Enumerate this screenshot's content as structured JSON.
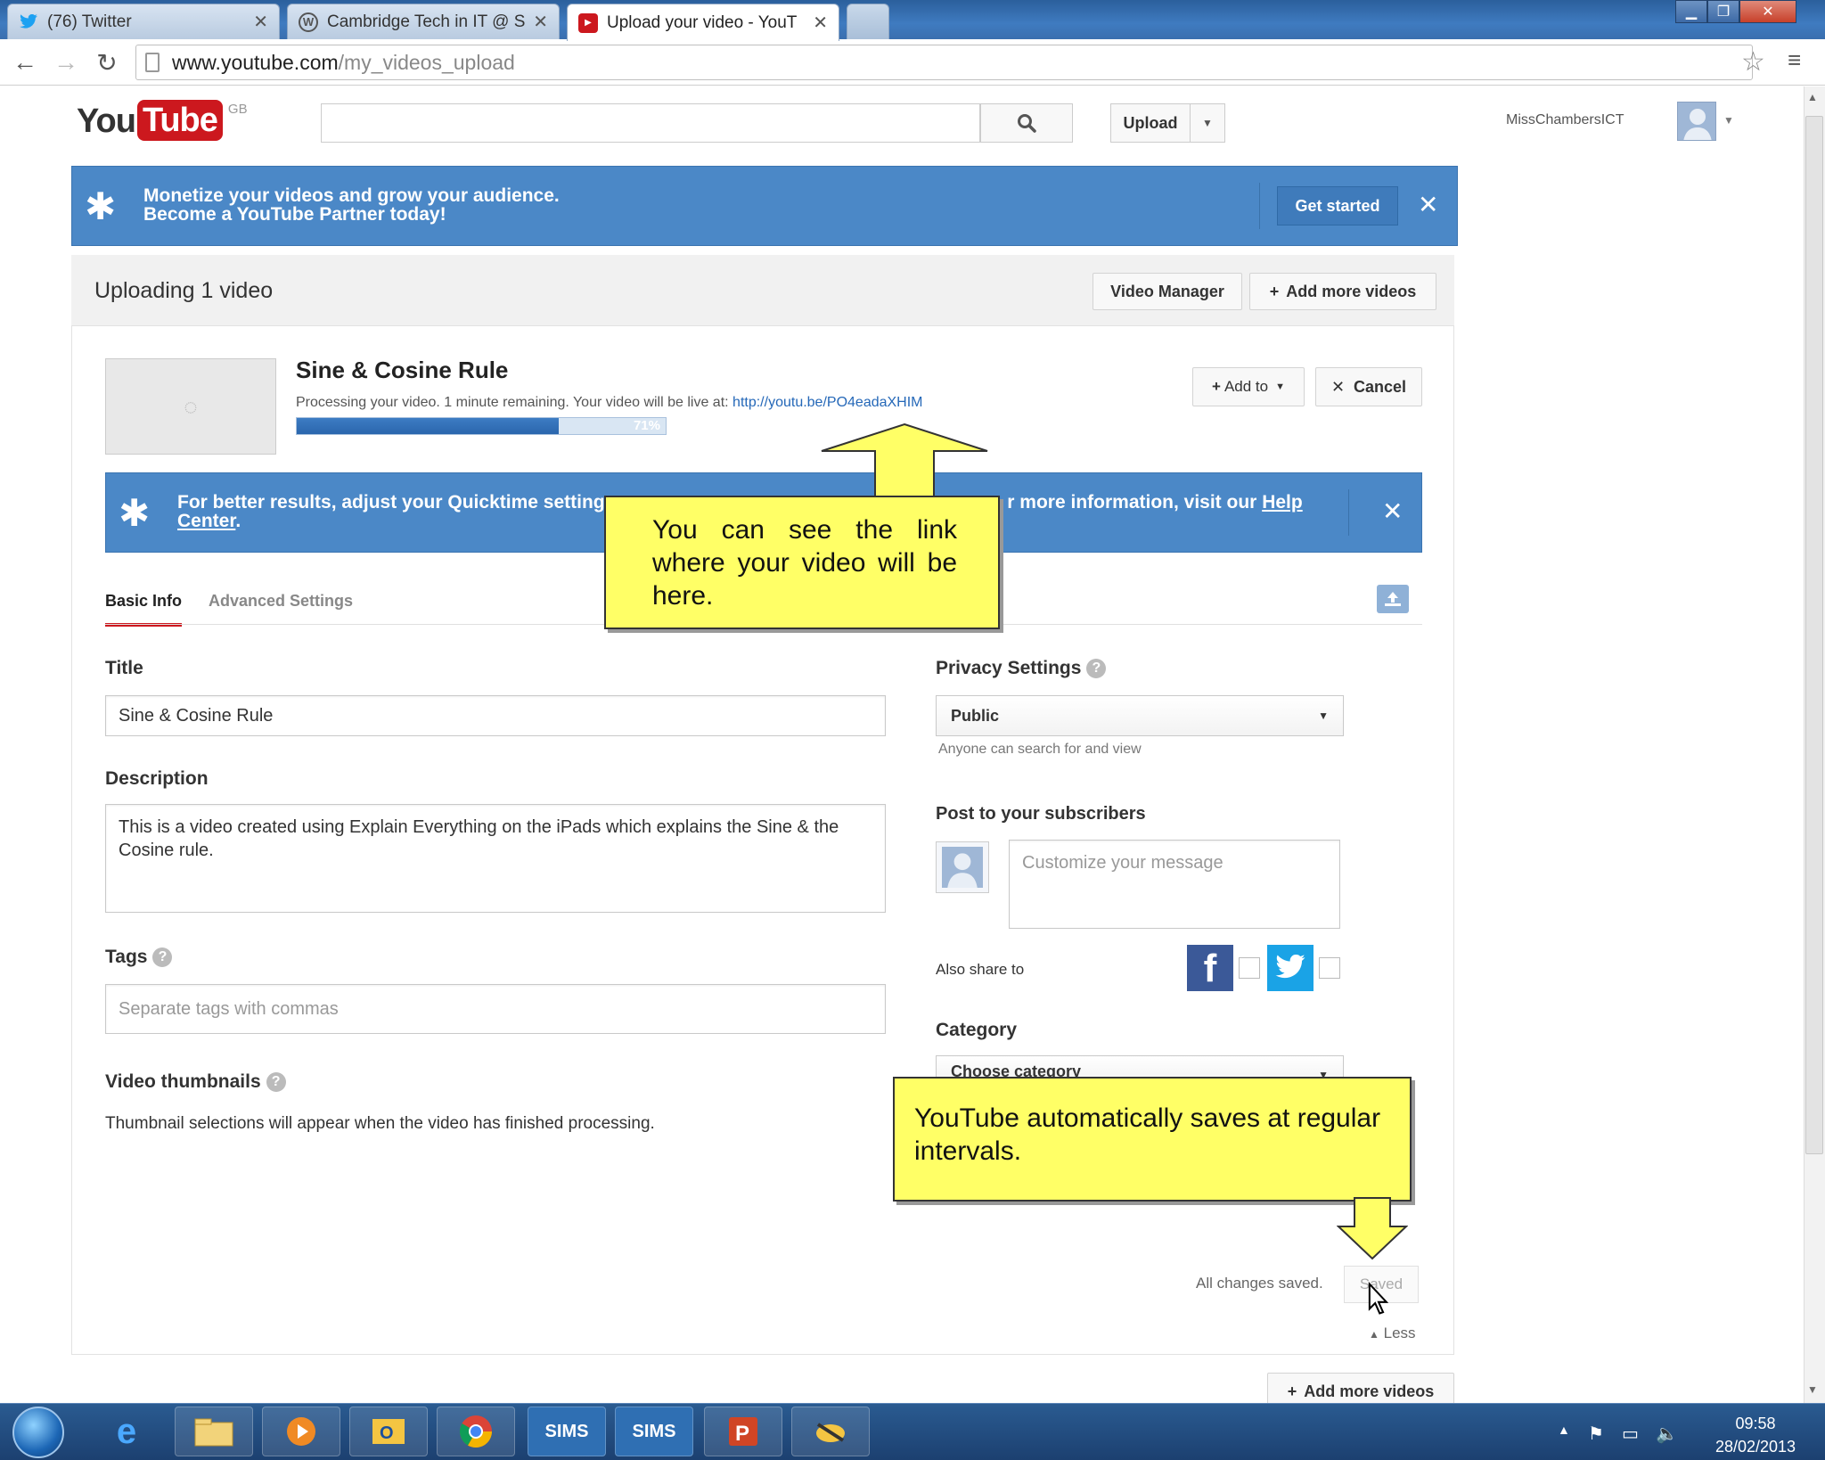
{
  "browser": {
    "tabs": [
      {
        "icon": "twitter-icon",
        "title": "(76) Twitter",
        "active": false
      },
      {
        "icon": "wordpress-icon",
        "title": "Cambridge Tech in IT @ S",
        "active": false
      },
      {
        "icon": "youtube-icon",
        "title": "Upload your video - YouT",
        "active": true
      }
    ],
    "url_host": "www.youtube.com",
    "url_path": "/my_videos_upload"
  },
  "header": {
    "logo_you": "You",
    "logo_tube": "Tube",
    "logo_region": "GB",
    "upload_label": "Upload",
    "username": "MissChambersICT"
  },
  "partner_banner": {
    "line1": "Monetize your videos and grow your audience.",
    "line2": "Become a YouTube Partner today!",
    "cta": "Get started"
  },
  "upload": {
    "heading": "Uploading 1 video",
    "video_manager": "Video Manager",
    "add_more": "Add more videos",
    "video_title": "Sine & Cosine Rule",
    "processing_text": "Processing your video. 1 minute remaining. Your video will be live at:",
    "video_link": "http://youtu.be/PO4eadaXHIM",
    "progress_label": "71%",
    "progress": 0.71,
    "add_to": "Add to",
    "cancel": "Cancel"
  },
  "quicktime_banner": {
    "text_before": "For better results, adjust your Quicktime setting",
    "text_after": "r more information, visit our",
    "link1": "Help",
    "link2": "Center",
    "end": "."
  },
  "tabs": {
    "basic": "Basic Info",
    "advanced": "Advanced Settings"
  },
  "form": {
    "title_label": "Title",
    "title_value": "Sine & Cosine Rule",
    "description_label": "Description",
    "description_value": "This is a video created using Explain Everything on the iPads which explains the Sine & the Cosine rule.",
    "tags_label": "Tags",
    "tags_placeholder": "Separate tags with commas",
    "thumbnails_label": "Video thumbnails",
    "thumbnails_text": "Thumbnail selections will appear when the video has finished processing.",
    "privacy_label": "Privacy Settings",
    "privacy_value": "Public",
    "privacy_hint": "Anyone can search for and view",
    "post_label": "Post to your subscribers",
    "message_placeholder": "Customize your message",
    "also_share": "Also share to",
    "category_label": "Category",
    "category_value": "Choose category",
    "saved_status": "All changes saved.",
    "saved_button": "Saved",
    "less": "Less"
  },
  "callouts": {
    "link_note": "You can see the link where your video will be here.",
    "save_note": "YouTube automatically saves at regular intervals."
  },
  "taskbar": {
    "apps": [
      "ie-icon",
      "explorer-icon",
      "media-player-icon",
      "outlook-icon",
      "chrome-icon",
      "SIMS",
      "SIMS",
      "powerpoint-icon",
      "app-icon"
    ],
    "time": "09:58",
    "date": "28/02/2013"
  },
  "colors": {
    "banner_blue": "#4b88c7",
    "youtube_red": "#cc181e",
    "callout_yellow": "#ffff66"
  }
}
